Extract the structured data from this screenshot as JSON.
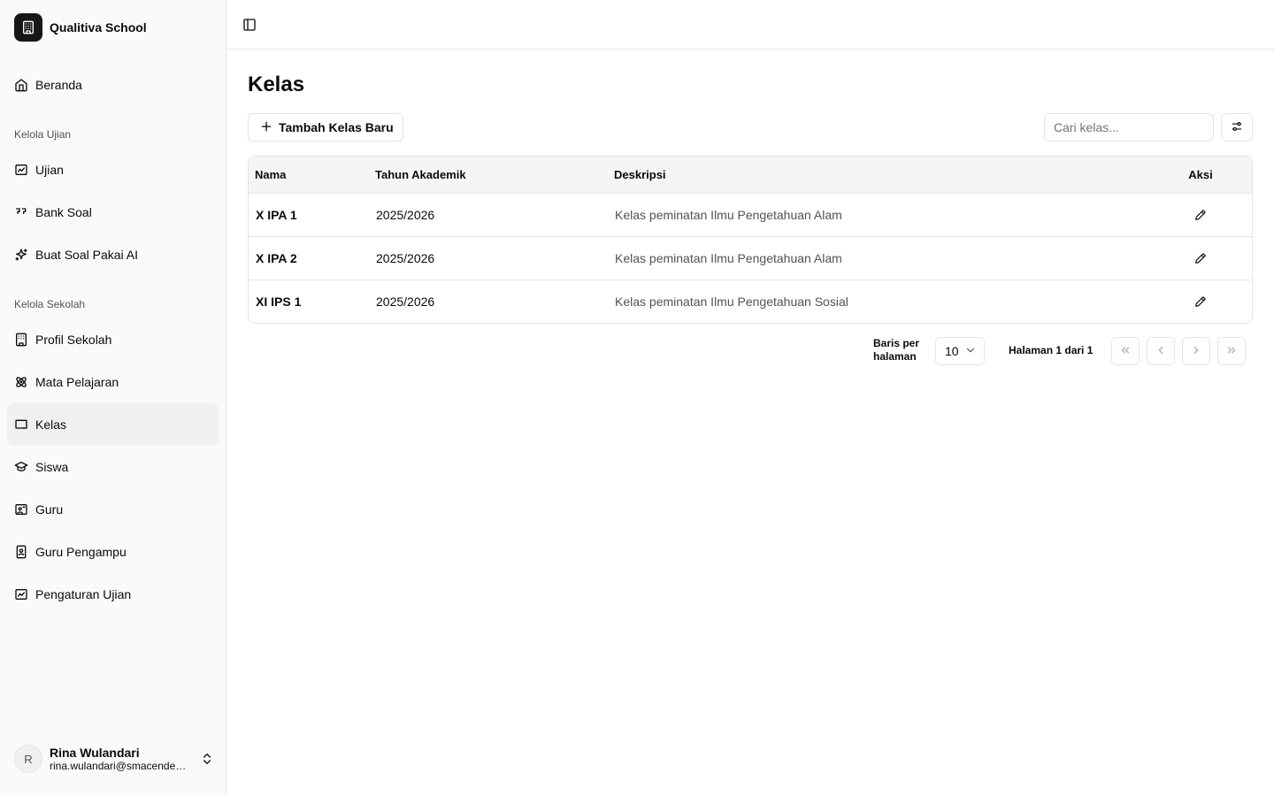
{
  "sidebar": {
    "brand": "Qualitiva School",
    "home": "Beranda",
    "groups": [
      {
        "label": "Kelola Ujian",
        "items": [
          "Ujian",
          "Bank Soal",
          "Buat Soal Pakai AI"
        ]
      },
      {
        "label": "Kelola Sekolah",
        "items": [
          "Profil Sekolah",
          "Mata Pelajaran",
          "Kelas",
          "Siswa",
          "Guru",
          "Guru Pengampu",
          "Pengaturan Ujian"
        ]
      }
    ],
    "active_item": "Kelas",
    "user": {
      "initial": "R",
      "name": "Rina Wulandari",
      "email": "rina.wulandari@smacendekia.sch.id"
    }
  },
  "main": {
    "title": "Kelas",
    "add_button": "Tambah Kelas Baru",
    "search_placeholder": "Cari kelas...",
    "table": {
      "headers": [
        "Nama",
        "Tahun Akademik",
        "Deskripsi",
        "Aksi"
      ],
      "rows": [
        [
          "X IPA 1",
          "2025/2026",
          "Kelas peminatan Ilmu Pengetahuan Alam"
        ],
        [
          "X IPA 2",
          "2025/2026",
          "Kelas peminatan Ilmu Pengetahuan Alam"
        ],
        [
          "XI IPS 1",
          "2025/2026",
          "Kelas peminatan Ilmu Pengetahuan Sosial"
        ]
      ]
    },
    "pagination": {
      "rows_per_page_label": "Baris per halaman",
      "rows_per_page": "10",
      "page_info": "Halaman 1 dari 1"
    }
  },
  "colors": {
    "sidebar_bg": "#fafafa",
    "active_bg": "#f0f0f0",
    "border": "#e5e5e5",
    "header_bg": "#f5f5f5",
    "brand_bg": "#171717"
  }
}
